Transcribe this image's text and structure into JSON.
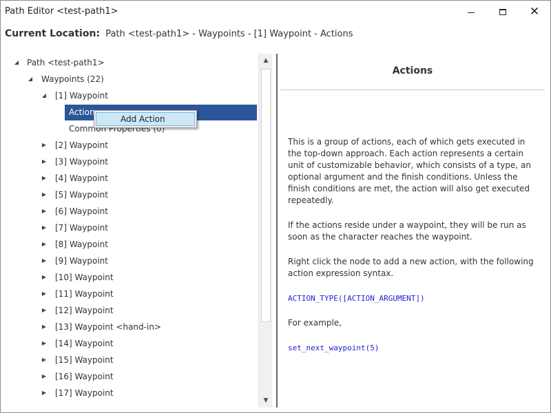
{
  "window": {
    "title": "Path Editor <test-path1>"
  },
  "location": {
    "label": "Current Location:",
    "path": "Path <test-path1> - Waypoints - [1] Waypoint - Actions"
  },
  "tree": {
    "root": "Path <test-path1>",
    "waypoints": "Waypoints (22)",
    "waypoint1": "[1] Waypoint",
    "actions": "Actions",
    "common_properties": "Common Properties (0)",
    "items": [
      "[2] Waypoint",
      "[3] Waypoint",
      "[4] Waypoint",
      "[5] Waypoint",
      "[6] Waypoint",
      "[7] Waypoint",
      "[8] Waypoint",
      "[9] Waypoint",
      "[10] Waypoint",
      "[11] Waypoint",
      "[12] Waypoint",
      "[13] Waypoint <hand-in>",
      "[14] Waypoint",
      "[15] Waypoint",
      "[16] Waypoint",
      "[17] Waypoint"
    ]
  },
  "context_menu": {
    "add_action": "Add Action"
  },
  "info": {
    "title": "Actions",
    "para1": "This is a group of actions, each of which gets executed in the top-down approach. Each action represents a certain unit of customizable behavior, which consists of a type, an optional argument and the finish conditions. Unless the finish conditions are met, the action will also get executed repeatedly.",
    "para2": "If the actions reside under a waypoint, they will be run as soon as the character reaches the waypoint.",
    "para3": "Right click the node to add a new action, with the following action expression syntax.",
    "syntax": "ACTION_TYPE([ACTION_ARGUMENT])",
    "example_label": "For example,",
    "example": "set_next_waypoint(5)"
  },
  "colors": {
    "selection": "#2b579a",
    "code": "#1f1fd0",
    "menu_highlight": "#cde8f5"
  }
}
